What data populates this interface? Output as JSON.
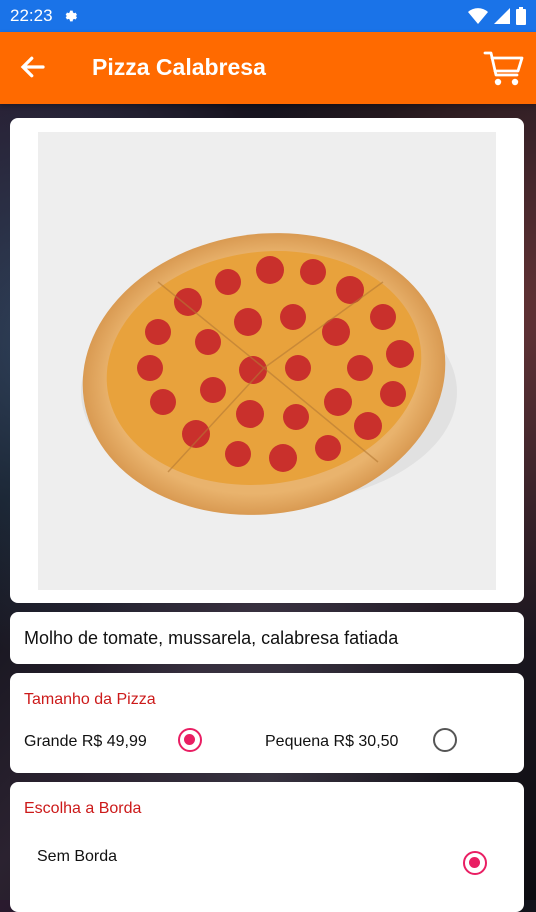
{
  "status_bar": {
    "time": "22:23"
  },
  "app_bar": {
    "title": "Pizza Calabresa"
  },
  "product": {
    "description": "Molho de tomate, mussarela, calabresa fatiada"
  },
  "size_section": {
    "title": "Tamanho da Pizza",
    "options": [
      {
        "label": "Grande R$ 49,99",
        "selected": true
      },
      {
        "label": "Pequena R$ 30,50",
        "selected": false
      }
    ]
  },
  "border_section": {
    "title": "Escolha a Borda",
    "options": [
      {
        "label": "Sem Borda",
        "selected": true
      }
    ]
  },
  "colors": {
    "app_bar": "#ff6a00",
    "status_bar": "#1a73e8",
    "section_title": "#cc1a1a",
    "radio_selected": "#e91e63"
  }
}
